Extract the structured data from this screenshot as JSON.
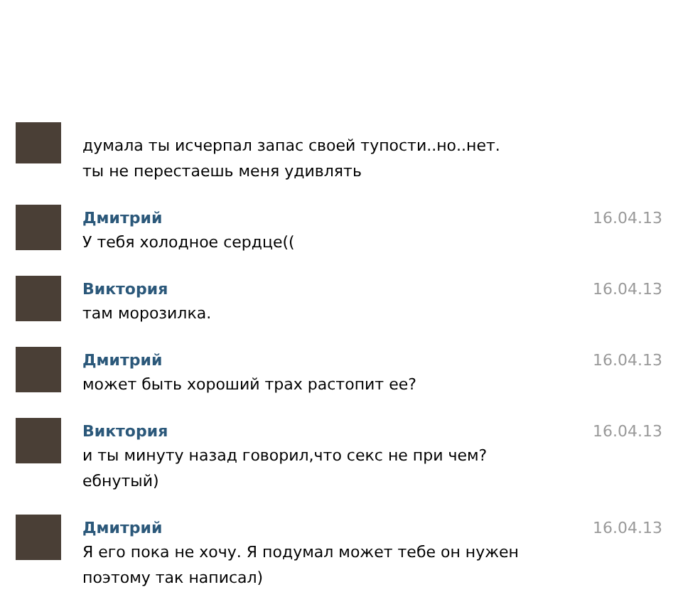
{
  "messages": [
    {
      "kind": "cut_top",
      "text": "думала ты исчерпал запас своей тупости..но..нет. ты не перестаешь меня удивлять"
    },
    {
      "kind": "full",
      "name": "Дмитрий",
      "date": "16.04.13",
      "text": "У тебя холодное сердце(("
    },
    {
      "kind": "full",
      "name": "Виктория",
      "date": "16.04.13",
      "text": "там морозилка."
    },
    {
      "kind": "full",
      "name": "Дмитрий",
      "date": "16.04.13",
      "text": "может быть хороший трах растопит ее?"
    },
    {
      "kind": "full",
      "name": "Виктория",
      "date": "16.04.13",
      "text": "и ты минуту назад говорил,что секс не при чем? ебнутый)"
    },
    {
      "kind": "full",
      "name": "Дмитрий",
      "date": "16.04.13",
      "text": "Я его пока не хочу. Я подумал может тебе он нужен поэтому так написал)"
    },
    {
      "kind": "cut_bottom"
    }
  ]
}
